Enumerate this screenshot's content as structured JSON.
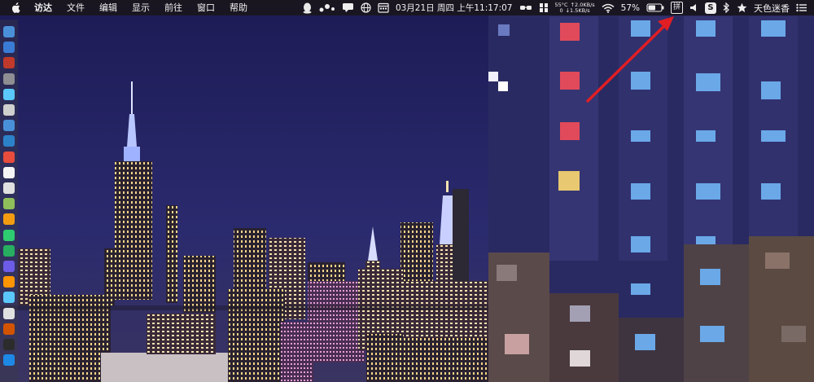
{
  "menubar": {
    "apple_icon": "apple-icon",
    "app_name": "访达",
    "menus": [
      "文件",
      "编辑",
      "显示",
      "前往",
      "窗口",
      "帮助"
    ]
  },
  "status": {
    "date_time": "03月21日 周四 上午11:17:07",
    "temperature": "55°C",
    "net_up": "↑2.0KB/s",
    "net_cpu": "0",
    "net_down": "↓1.5KB/s",
    "battery_percent": "57%",
    "input_method_badge": "拼",
    "sogou_badge": "S",
    "user_name": "天色迷香"
  },
  "icons": {
    "status_order": [
      "qq-icon",
      "dots-icon",
      "message-icon",
      "globe-icon",
      "calendar-icon",
      "glasses-icon",
      "puzzle-icon",
      "temperature-net-stats",
      "wifi-icon",
      "battery-icon",
      "input-method-icon",
      "volume-icon",
      "sogou-icon",
      "bluetooth-icon",
      "star-icon",
      "user-name",
      "list-icon"
    ]
  },
  "annotation": {
    "arrow_color": "#e01e24",
    "points_to": "input-method-icon"
  },
  "dock": {
    "icon_colors": [
      "#4a90d9",
      "#3a7bd5",
      "#c0392b",
      "#8e8e93",
      "#5ac8fa",
      "#cfcfcf",
      "#4a90d9",
      "#2c82c9",
      "#e74c3c",
      "#f5f5f5",
      "#e0e0e0",
      "#8fbf5a",
      "#f39c12",
      "#2ecc71",
      "#27ae60",
      "#6c5ce7",
      "#ff9500",
      "#5ac8fa",
      "#e0e0e0",
      "#d35400",
      "#2c2c2c",
      "#1e88e5"
    ]
  },
  "wallpaper": {
    "sky_color": "#22205a",
    "description_colors": [
      "#2a2a6e",
      "#1c1a4e"
    ]
  }
}
